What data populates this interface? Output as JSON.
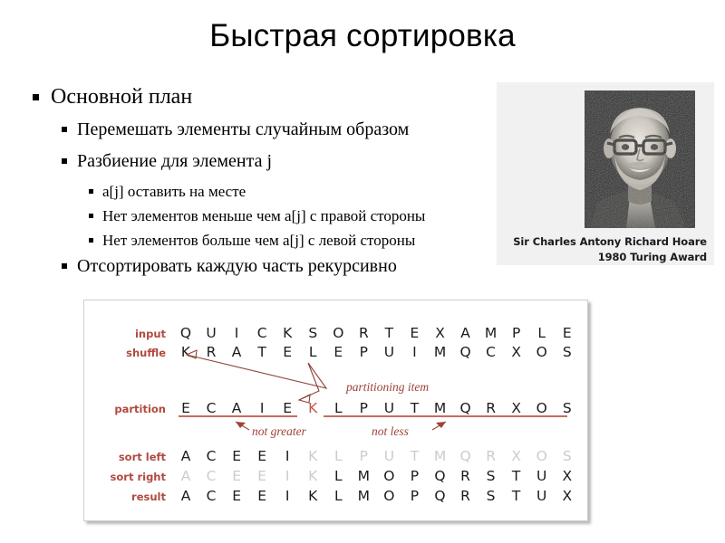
{
  "slide": {
    "title": "Быстрая сортировка"
  },
  "outline": [
    {
      "level": 1,
      "text": "Основной план"
    },
    {
      "level": 2,
      "text": "Перемешать элементы случайным образом"
    },
    {
      "level": 2,
      "text": "Разбиение для элемента j"
    },
    {
      "level": 3,
      "text": "a[j] оставить на месте"
    },
    {
      "level": 3,
      "text": "Нет элементов меньше чем a[j] с правой стороны"
    },
    {
      "level": 3,
      "text": "Нет элементов больше чем a[j] с левой стороны"
    },
    {
      "level": 2,
      "text": "Отсортировать каждую часть рекурсивно"
    }
  ],
  "portrait": {
    "caption_line1": "Sir Charles Antony Richard Hoare",
    "caption_line2": "1980 Turing Award",
    "alt": "photo-of-tony-hoare"
  },
  "trace": {
    "rows": [
      {
        "label": "input",
        "cells": [
          "Q",
          "U",
          "I",
          "C",
          "K",
          "S",
          "O",
          "R",
          "T",
          "E",
          "X",
          "A",
          "M",
          "P",
          "L",
          "E"
        ],
        "dim": [],
        "pivot": -1
      },
      {
        "label": "shuffle",
        "cells": [
          "K",
          "R",
          "A",
          "T",
          "E",
          "L",
          "E",
          "P",
          "U",
          "I",
          "M",
          "Q",
          "C",
          "X",
          "O",
          "S"
        ],
        "dim": [],
        "pivot": -1
      },
      {
        "label": "partition",
        "cells": [
          "E",
          "C",
          "A",
          "I",
          "E",
          "K",
          "L",
          "P",
          "U",
          "T",
          "M",
          "Q",
          "R",
          "X",
          "O",
          "S"
        ],
        "dim": [],
        "pivot": 5
      },
      {
        "label": "sort left",
        "cells": [
          "A",
          "C",
          "E",
          "E",
          "I",
          "K",
          "L",
          "P",
          "U",
          "T",
          "M",
          "Q",
          "R",
          "X",
          "O",
          "S"
        ],
        "dim": [
          5,
          6,
          7,
          8,
          9,
          10,
          11,
          12,
          13,
          14,
          15
        ],
        "pivot": -1
      },
      {
        "label": "sort right",
        "cells": [
          "A",
          "C",
          "E",
          "E",
          "I",
          "K",
          "L",
          "M",
          "O",
          "P",
          "Q",
          "R",
          "S",
          "T",
          "U",
          "X"
        ],
        "dim": [
          0,
          1,
          2,
          3,
          4,
          5
        ],
        "pivot": -1
      },
      {
        "label": "result",
        "cells": [
          "A",
          "C",
          "E",
          "E",
          "I",
          "K",
          "L",
          "M",
          "O",
          "P",
          "Q",
          "R",
          "S",
          "T",
          "U",
          "X"
        ],
        "dim": [],
        "pivot": -1
      }
    ],
    "annotations": {
      "partitioning_item": "partitioning item",
      "not_greater": "not greater",
      "not_less": "not less"
    },
    "colors": {
      "label": "#b04a40",
      "annotation": "#9e4237",
      "rule": "#b23b2e",
      "pivot": "#c0564a",
      "cell": "#1c1c1c",
      "dim_cell": "#cccccc"
    }
  }
}
